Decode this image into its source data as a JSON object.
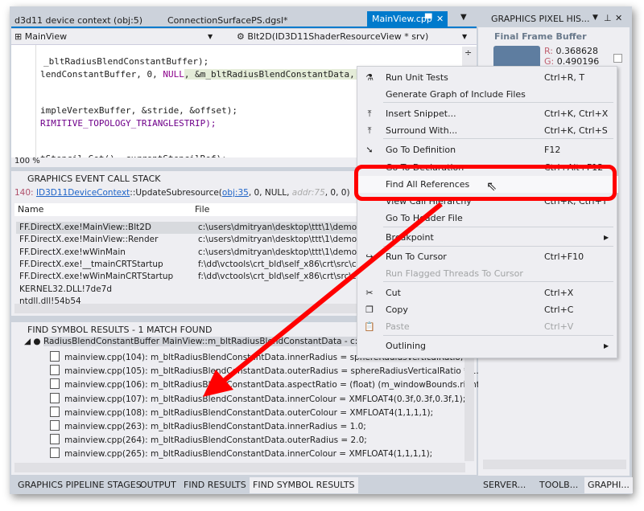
{
  "tabs": [
    {
      "label": "d3d11 device context (obj:5)"
    },
    {
      "label": "ConnectionSurfacePS.dgsl*"
    },
    {
      "label": "MainView.cpp",
      "active": true
    }
  ],
  "nav": {
    "class": "MainView",
    "member": "Blt2D(ID3D11ShaderResourceView * srv)"
  },
  "code": {
    "lines": [
      "_bltRadiusBlendConstantBuffer);",
      "lendConstantBuffer, 0, ",
      "NULL",
      ", &m_bltRadiusBlendConstantData, 0, 0);",
      "impleVertexBuffer, &stride, &offset);",
      "RIMITIVE_TOPOLOGY_TRIANGLESTRIP);",
      "tStencil.Get(), currentStencilRef);"
    ],
    "zoom": "100 %"
  },
  "callstack": {
    "title": "GRAPHICS EVENT CALL STACK",
    "event": {
      "num": "140:",
      "iface": "ID3D11DeviceContext",
      "method": "::UpdateSubresource(",
      "obj": "obj:35",
      "args1": ", 0, NULL, ",
      "addr": "addr:75",
      "args2": ", 0, 0)"
    },
    "columns": [
      "Name",
      "File"
    ],
    "rows": [
      [
        "FF.DirectX.exe!MainView::Blt2D",
        "c:\\users\\dmitryan\\desktop\\ttt\\1\\demo"
      ],
      [
        "FF.DirectX.exe!MainView::Render",
        "c:\\users\\dmitryan\\desktop\\ttt\\1\\demo"
      ],
      [
        "FF.DirectX.exe!wWinMain",
        "c:\\users\\dmitryan\\desktop\\ttt\\1\\demo"
      ],
      [
        "FF.DirectX.exe!__tmainCRTStartup",
        "f:\\dd\\vctools\\crt_bld\\self_x86\\crt\\src\\c"
      ],
      [
        "FF.DirectX.exe!wWinMainCRTStartup",
        "f:\\dd\\vctools\\crt_bld\\self_x86\\crt\\src\\c"
      ],
      [
        "KERNEL32.DLL!7de7d",
        ""
      ],
      [
        "ntdll.dll!54b54",
        ""
      ]
    ]
  },
  "findsym": {
    "title": "FIND SYMBOL RESULTS - 1 MATCH FOUND",
    "root": "RadiusBlendConstantBuffer MainView::m_bltRadiusBlendConstantData - c:\\U",
    "rows": [
      "mainview.cpp(104): m_bltRadiusBlendConstantData.innerRadius = sphereRadiusVerticalRatio;",
      "mainview.cpp(105): m_bltRadiusBlendConstantData.outerRadius = sphereRadiusVerticalRatio * 1.3f;",
      "mainview.cpp(106): m_bltRadiusBlendConstantData.aspectRatio = (float)  (m_windowBounds.right",
      "mainview.cpp(107): m_bltRadiusBlendConstantData.innerColour = XMFLOAT4(0.3f,0.3f,0.3f,1);",
      "mainview.cpp(108): m_bltRadiusBlendConstantData.outerColour = XMFLOAT4(1,1,1,1);",
      "mainview.cpp(263): m_bltRadiusBlendConstantData.innerRadius = 1.0;",
      "mainview.cpp(264): m_bltRadiusBlendConstantData.outerRadius = 2.0;",
      "mainview.cpp(265): m_bltRadiusBlendConstantData.innerColour = XMFLOAT4(1,1,1,1);"
    ]
  },
  "bottom_tabs": [
    "GRAPHICS PIPELINE STAGES",
    "OUTPUT",
    "FIND RESULTS 1",
    "FIND SYMBOL RESULTS"
  ],
  "pixel": {
    "title": "GRAPHICS PIXEL HIS...",
    "subtitle": "Final Frame Buffer",
    "r_label": "R:",
    "r": "0.368628",
    "g_label": "G:",
    "g": "0.490196",
    "swatch": "#5e7da0"
  },
  "right_tabs": [
    "SERVER...",
    "TOOLB...",
    "GRAPHI..."
  ],
  "menu": [
    {
      "label": "Run Unit Tests",
      "key": "Ctrl+R, T",
      "icon": "flask-icon"
    },
    {
      "label": "Generate Graph of Include Files",
      "key": ""
    },
    {
      "label": "Insert Snippet...",
      "key": "Ctrl+K, Ctrl+X",
      "icon": "snippet-icon"
    },
    {
      "label": "Surround With...",
      "key": "Ctrl+K, Ctrl+S",
      "icon": "snippet-icon"
    },
    {
      "label": "Go To Definition",
      "key": "F12",
      "icon": "goto-icon"
    },
    {
      "label": "Go To Declaration",
      "key": "Ctrl+Alt+F12"
    },
    {
      "label": "Find All References",
      "key": "",
      "highlighted": true
    },
    {
      "label": "View Call Hierarchy",
      "key": "Ctrl+K, Ctrl+T"
    },
    {
      "label": "Go To Header File",
      "key": ""
    },
    {
      "label": "Breakpoint",
      "key": "",
      "submenu": true
    },
    {
      "label": "Run To Cursor",
      "key": "Ctrl+F10",
      "icon": "run-cursor-icon"
    },
    {
      "label": "Run Flagged Threads To Cursor",
      "key": "",
      "disabled": true
    },
    {
      "label": "Cut",
      "key": "Ctrl+X",
      "icon": "scissors-icon"
    },
    {
      "label": "Copy",
      "key": "Ctrl+C",
      "icon": "copy-icon"
    },
    {
      "label": "Paste",
      "key": "Ctrl+V",
      "icon": "paste-icon",
      "disabled": true
    },
    {
      "label": "Outlining",
      "key": "",
      "submenu": true
    }
  ],
  "colors": {
    "accent": "#007acc",
    "annotation": "#ff0000"
  }
}
